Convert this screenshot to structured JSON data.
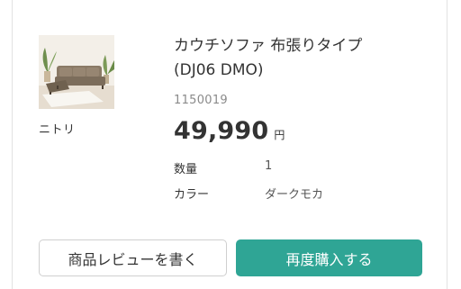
{
  "product": {
    "maker": "ニトリ",
    "title_line1": "カウチソファ 布張りタイプ",
    "title_line2": "(DJ06 DMO)",
    "sku": "1150019",
    "price": "49,990",
    "price_unit": "円"
  },
  "specs": {
    "quantity_label": "数量",
    "quantity_value": "1",
    "color_label": "カラー",
    "color_value": "ダークモカ"
  },
  "actions": {
    "review_label": "商品レビューを書く",
    "rebuy_label": "再度購入する"
  },
  "colors": {
    "accent": "#2fa595",
    "text": "#333333",
    "muted": "#8a8a8a",
    "border": "#cfcfcf"
  },
  "icons": {
    "product_image": "couch-sofa-image"
  }
}
